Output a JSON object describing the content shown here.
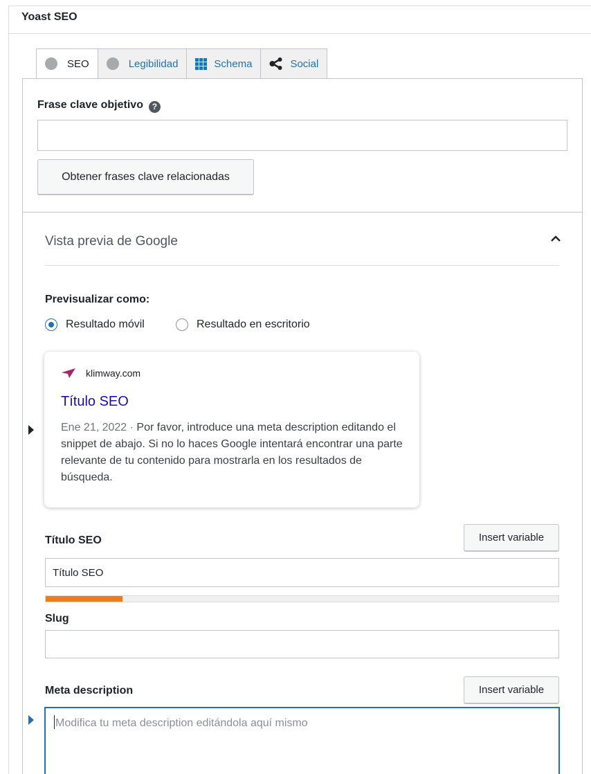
{
  "panel": {
    "title": "Yoast SEO"
  },
  "tabs": [
    {
      "label": "SEO",
      "icon": "gray-dot-icon"
    },
    {
      "label": "Legibilidad",
      "icon": "gray-dot-icon"
    },
    {
      "label": "Schema",
      "icon": "grid-icon"
    },
    {
      "label": "Social",
      "icon": "share-icon"
    }
  ],
  "keyphrase": {
    "label": "Frase clave objetivo",
    "help": "?",
    "value": "",
    "related_button": "Obtener frases clave relacionadas"
  },
  "google_preview": {
    "title": "Vista previa de Google",
    "preview_as_label": "Previsualizar como:",
    "options": [
      "Resultado móvil",
      "Resultado en escritorio"
    ],
    "selected": "Resultado móvil",
    "serp": {
      "site": "klimway.com",
      "title": "Título SEO",
      "date": "Ene 21, 2022 ·",
      "description": "Por favor, introduce una meta description editando el snippet de abajo. Si no lo haces Google intentará encontrar una parte relevante de tu contenido para mostrarla en los resultados de búsqueda."
    }
  },
  "seo_title": {
    "label": "Título SEO",
    "insert_button": "Insert variable",
    "value": "Título SEO",
    "progress": 0.15
  },
  "slug": {
    "label": "Slug",
    "value": ""
  },
  "meta_description": {
    "label": "Meta description",
    "insert_button": "Insert variable",
    "placeholder": "Modifica tu meta description editándola aquí mismo"
  },
  "colors": {
    "link": "#2271b1",
    "serp_title": "#1a0dab",
    "progress": "#ee7c1b",
    "brand_icon": "#a4286a"
  }
}
